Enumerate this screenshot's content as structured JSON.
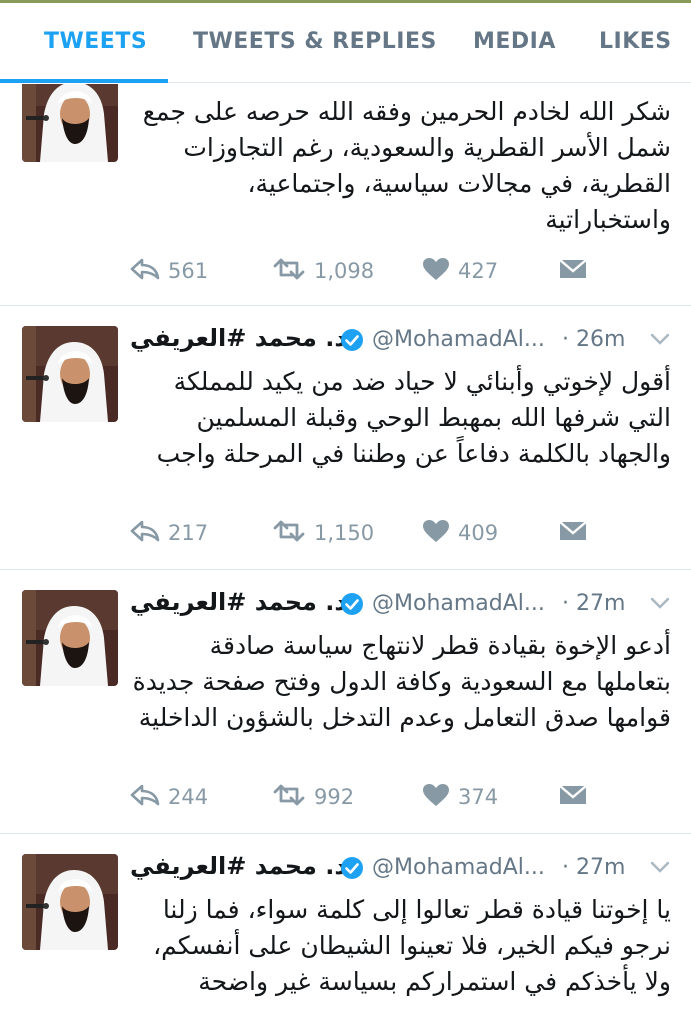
{
  "tabs": [
    {
      "label": "TWEETS",
      "active": true
    },
    {
      "label": "TWEETS & REPLIES",
      "active": false
    },
    {
      "label": "MEDIA",
      "active": false
    },
    {
      "label": "LIKES",
      "active": false
    }
  ],
  "colors": {
    "accent": "#1da1f2",
    "muted": "#657786",
    "icon": "#8899a6",
    "text": "#14171a"
  },
  "tweets": [
    {
      "name": "",
      "handle": "",
      "time": "",
      "text": "شكر الله لخادم الحرمين وفقه الله حرصه على جمع شمل الأسر القطرية والسعودية، رغم التجاوزات القطرية، في مجالات سياسية، واجتماعية، واستخباراتية",
      "reply_count": "561",
      "retweet_count": "1,098",
      "like_count": "427"
    },
    {
      "name": "د. محمد #العريفي",
      "handle": "@MohamadAl...",
      "time": "· 26m",
      "text": "أقول لإخوتي وأبنائي لا حياد ضد من يكيد للمملكة التي شرفها الله بمهبط الوحي وقبلة المسلمين والجهاد بالكلمة دفاعاً عن وطننا في المرحلة واجب",
      "reply_count": "217",
      "retweet_count": "1,150",
      "like_count": "409"
    },
    {
      "name": "د. محمد #العريفي",
      "handle": "@MohamadAl...",
      "time": "· 27m",
      "text": "أدعو الإخوة بقيادة قطر لانتهاج سياسة صادقة بتعاملها مع السعودية وكافة الدول وفتح صفحة جديدة قوامها صدق التعامل وعدم التدخل بالشؤون الداخلية",
      "reply_count": "244",
      "retweet_count": "992",
      "like_count": "374"
    },
    {
      "name": "د. محمد #العريفي",
      "handle": "@MohamadAl...",
      "time": "· 27m",
      "text": "يا إخوتنا قيادة قطر تعالوا إلى كلمة سواء، فما زلنا نرجو فيكم الخير، فلا تعينوا الشيطان على أنفسكم، ولا يأخذكم في استمراركم بسياسة غير واضحة",
      "reply_count": "",
      "retweet_count": "",
      "like_count": ""
    }
  ],
  "icons": {
    "reply": "reply-icon",
    "retweet": "retweet-icon",
    "like": "heart-icon",
    "dm": "envelope-icon",
    "verified": "verified-badge-icon",
    "menu": "chevron-down-icon"
  }
}
